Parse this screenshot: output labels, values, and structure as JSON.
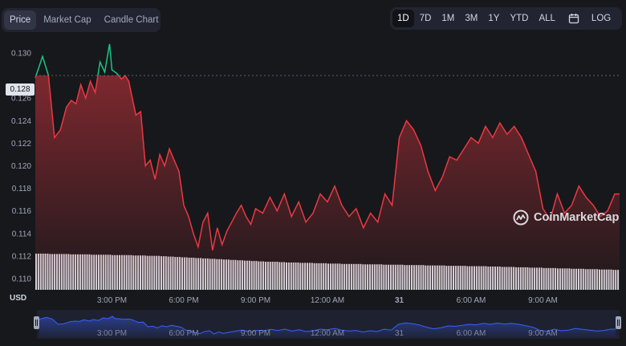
{
  "tabs": [
    {
      "label": "Price",
      "active": true
    },
    {
      "label": "Market Cap",
      "active": false
    },
    {
      "label": "Candle Chart",
      "active": false
    }
  ],
  "ranges": [
    {
      "label": "1D",
      "active": true
    },
    {
      "label": "7D",
      "active": false
    },
    {
      "label": "1M",
      "active": false
    },
    {
      "label": "3M",
      "active": false
    },
    {
      "label": "1Y",
      "active": false
    },
    {
      "label": "YTD",
      "active": false
    },
    {
      "label": "ALL",
      "active": false
    }
  ],
  "calendar_icon": "calendar-icon",
  "log_label": "LOG",
  "currency_label": "USD",
  "current_price_label": "0.128",
  "watermark": "CoinMarketCap",
  "colors": {
    "up": "#16c784",
    "down": "#ea3943",
    "accent": "#3861fb"
  },
  "chart_data": {
    "type": "line",
    "baseline": 0.128,
    "ylim": [
      0.109,
      0.1315
    ],
    "y_ticks": [
      "0.110",
      "0.112",
      "0.114",
      "0.116",
      "0.118",
      "0.120",
      "0.122",
      "0.124",
      "0.126",
      "0.128",
      "0.130"
    ],
    "x_ticks": [
      "3:00 PM",
      "6:00 PM",
      "9:00 PM",
      "12:00 AM",
      "31",
      "6:00 AM",
      "9:00 AM"
    ],
    "x_tick_hours": [
      3,
      6,
      9,
      12,
      15,
      18,
      21
    ],
    "x_range_hours": [
      -0.2,
      24.2
    ],
    "series": [
      {
        "x": [
          -0.2,
          0.1,
          0.35,
          0.6,
          0.85,
          1.1,
          1.3,
          1.5,
          1.7,
          1.9,
          2.1,
          2.3,
          2.5,
          2.7,
          2.9,
          3.0,
          3.2,
          3.4,
          3.55,
          3.7,
          3.85,
          4.0,
          4.2,
          4.4,
          4.6,
          4.8,
          5.0,
          5.2,
          5.4,
          5.6,
          5.8,
          6.0,
          6.2,
          6.4,
          6.6,
          6.8,
          7.0,
          7.2,
          7.4,
          7.6,
          7.8,
          8.0,
          8.2,
          8.4,
          8.6,
          8.8,
          9.0,
          9.3,
          9.6,
          9.9,
          10.2,
          10.5,
          10.8,
          11.1,
          11.4,
          11.7,
          12.0,
          12.3,
          12.6,
          12.9,
          13.2,
          13.5,
          13.8,
          14.1,
          14.4,
          14.7,
          15.0,
          15.3,
          15.6,
          15.9,
          16.2,
          16.5,
          16.8,
          17.1,
          17.4,
          17.7,
          18.0,
          18.3,
          18.6,
          18.9,
          19.2,
          19.5,
          19.8,
          20.1,
          20.4,
          20.7,
          21.0,
          21.3,
          21.6,
          21.9,
          22.2,
          22.5,
          22.8,
          23.1,
          23.4,
          23.7,
          24.0,
          24.2
        ],
        "values": [
          0.1278,
          0.1297,
          0.128,
          0.1225,
          0.1232,
          0.1252,
          0.1258,
          0.1255,
          0.1272,
          0.126,
          0.1275,
          0.1265,
          0.1292,
          0.1283,
          0.1308,
          0.1285,
          0.1282,
          0.1277,
          0.128,
          0.1275,
          0.126,
          0.1245,
          0.1248,
          0.12,
          0.1205,
          0.1188,
          0.121,
          0.12,
          0.1215,
          0.1205,
          0.1195,
          0.1165,
          0.1155,
          0.114,
          0.1128,
          0.115,
          0.1158,
          0.1125,
          0.1145,
          0.113,
          0.1142,
          0.115,
          0.1158,
          0.1165,
          0.1155,
          0.1148,
          0.1162,
          0.1158,
          0.1172,
          0.116,
          0.1175,
          0.1155,
          0.1168,
          0.115,
          0.1158,
          0.1175,
          0.1168,
          0.1182,
          0.1165,
          0.1155,
          0.1162,
          0.1145,
          0.1158,
          0.115,
          0.1175,
          0.1165,
          0.1225,
          0.124,
          0.1232,
          0.1218,
          0.1195,
          0.1178,
          0.119,
          0.1208,
          0.1205,
          0.1215,
          0.1225,
          0.122,
          0.1235,
          0.1225,
          0.1238,
          0.1228,
          0.1235,
          0.1225,
          0.121,
          0.1195,
          0.1162,
          0.1152,
          0.1175,
          0.1158,
          0.1165,
          0.1182,
          0.1172,
          0.1165,
          0.1155,
          0.116,
          0.1175,
          0.1175
        ]
      }
    ],
    "volume": [
      0.98,
      0.98,
      0.97,
      0.97,
      0.97,
      0.96,
      0.96,
      0.96,
      0.95,
      0.95,
      0.95,
      0.94,
      0.94,
      0.94,
      0.93,
      0.93,
      0.92,
      0.92,
      0.91,
      0.9,
      0.89,
      0.88,
      0.87,
      0.86,
      0.85,
      0.84,
      0.83,
      0.82,
      0.81,
      0.8,
      0.79,
      0.78,
      0.77,
      0.76,
      0.76,
      0.75,
      0.74,
      0.74,
      0.73,
      0.73,
      0.72,
      0.72,
      0.71,
      0.71,
      0.7,
      0.7,
      0.7,
      0.69,
      0.69,
      0.69,
      0.68,
      0.68,
      0.68,
      0.67,
      0.67,
      0.67,
      0.66,
      0.66,
      0.66,
      0.65,
      0.65,
      0.65,
      0.64,
      0.64,
      0.64,
      0.63,
      0.63,
      0.62,
      0.62,
      0.61,
      0.61,
      0.6,
      0.6,
      0.59,
      0.59,
      0.58,
      0.58,
      0.57,
      0.57,
      0.56,
      0.56,
      0.55,
      0.55,
      0.54
    ]
  }
}
